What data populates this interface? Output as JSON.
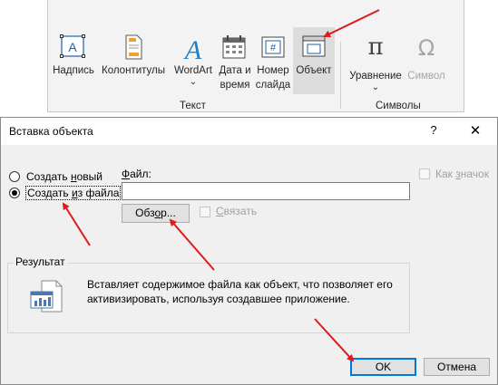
{
  "ribbon": {
    "buttons": [
      {
        "label_lines": [
          "Надпись"
        ],
        "icon": "text-box-icon"
      },
      {
        "label_lines": [
          "Колонтитулы"
        ],
        "icon": "header-footer-icon"
      },
      {
        "label_lines": [
          "WordArt",
          "⌄"
        ],
        "icon": "wordart-icon"
      },
      {
        "label_lines": [
          "Дата и",
          "время"
        ],
        "icon": "calendar-icon"
      },
      {
        "label_lines": [
          "Номер",
          "слайда"
        ],
        "icon": "slide-number-icon"
      },
      {
        "label_lines": [
          "Объект"
        ],
        "icon": "object-icon"
      },
      {
        "label_lines": [
          "Уравнение",
          "⌄"
        ],
        "icon": "pi-equation-icon"
      },
      {
        "label_lines": [
          "Символ"
        ],
        "icon": "omega-symbol-icon"
      }
    ],
    "groups": {
      "text": "Текст",
      "symbols": "Символы"
    }
  },
  "dialog": {
    "title": "Вставка объекта",
    "help": "?",
    "close": "✕",
    "create_new": {
      "pre": "Создать ",
      "accel": "н",
      "post": "овый"
    },
    "create_from_file": {
      "pre": "Создать ",
      "accel": "и",
      "post": "з файла"
    },
    "file_label": {
      "accel": "Ф",
      "post": "айл:"
    },
    "file_value": "",
    "browse": {
      "pre": "Обз",
      "accel": "о",
      "post": "р..."
    },
    "link": {
      "accel": "С",
      "post": "вязать"
    },
    "as_icon": {
      "pre": "Как ",
      "accel": "з",
      "post": "начок"
    },
    "result_label": "Результат",
    "result_line1": "Вставляет содержимое файла как объект, что позволяет его",
    "result_line2": "активизировать, используя создавшее приложение.",
    "ok": "OK",
    "cancel": "Отмена"
  },
  "colors": {
    "accent_blue": "#1f5fa6",
    "arrow_red": "#e01a1a",
    "ok_border": "#0078d7"
  }
}
